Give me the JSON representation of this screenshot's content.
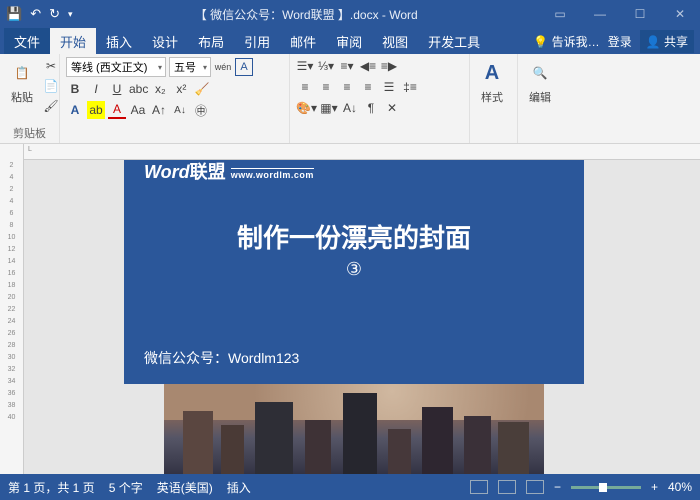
{
  "titlebar": {
    "title": "【 微信公众号：Word联盟 】.docx - Word"
  },
  "tabs": {
    "file": "文件",
    "items": [
      "开始",
      "插入",
      "设计",
      "布局",
      "引用",
      "邮件",
      "审阅",
      "视图",
      "开发工具"
    ],
    "active_index": 0,
    "tell_me": "告诉我…",
    "login": "登录",
    "share": "共享"
  },
  "ribbon": {
    "clipboard": {
      "paste": "粘贴",
      "label": "剪贴板"
    },
    "font": {
      "name": "等线 (西文正文)",
      "size": "五号",
      "pinyin": "wén",
      "boxA": "A"
    },
    "styles": {
      "label": "样式"
    },
    "editing": {
      "label": "编辑"
    }
  },
  "ruler": {
    "left_mark": "L",
    "v_marks": [
      "2",
      "4",
      "2",
      "4",
      "6",
      "8",
      "10",
      "12",
      "14",
      "16",
      "18",
      "20",
      "22",
      "24",
      "26",
      "28",
      "30",
      "32",
      "34",
      "36",
      "38",
      "40"
    ]
  },
  "slide": {
    "logo_main": "Word",
    "logo_cn": "联盟",
    "logo_url": "www.wordlm.com",
    "title": "制作一份漂亮的封面",
    "number": "③",
    "footer": "微信公众号：Wordlm123"
  },
  "statusbar": {
    "page": "第 1 页，共 1 页",
    "words": "5 个字",
    "lang": "英语(美国)",
    "insert": "插入",
    "zoom_minus": "−",
    "zoom_plus": "+",
    "zoom": "40%"
  }
}
